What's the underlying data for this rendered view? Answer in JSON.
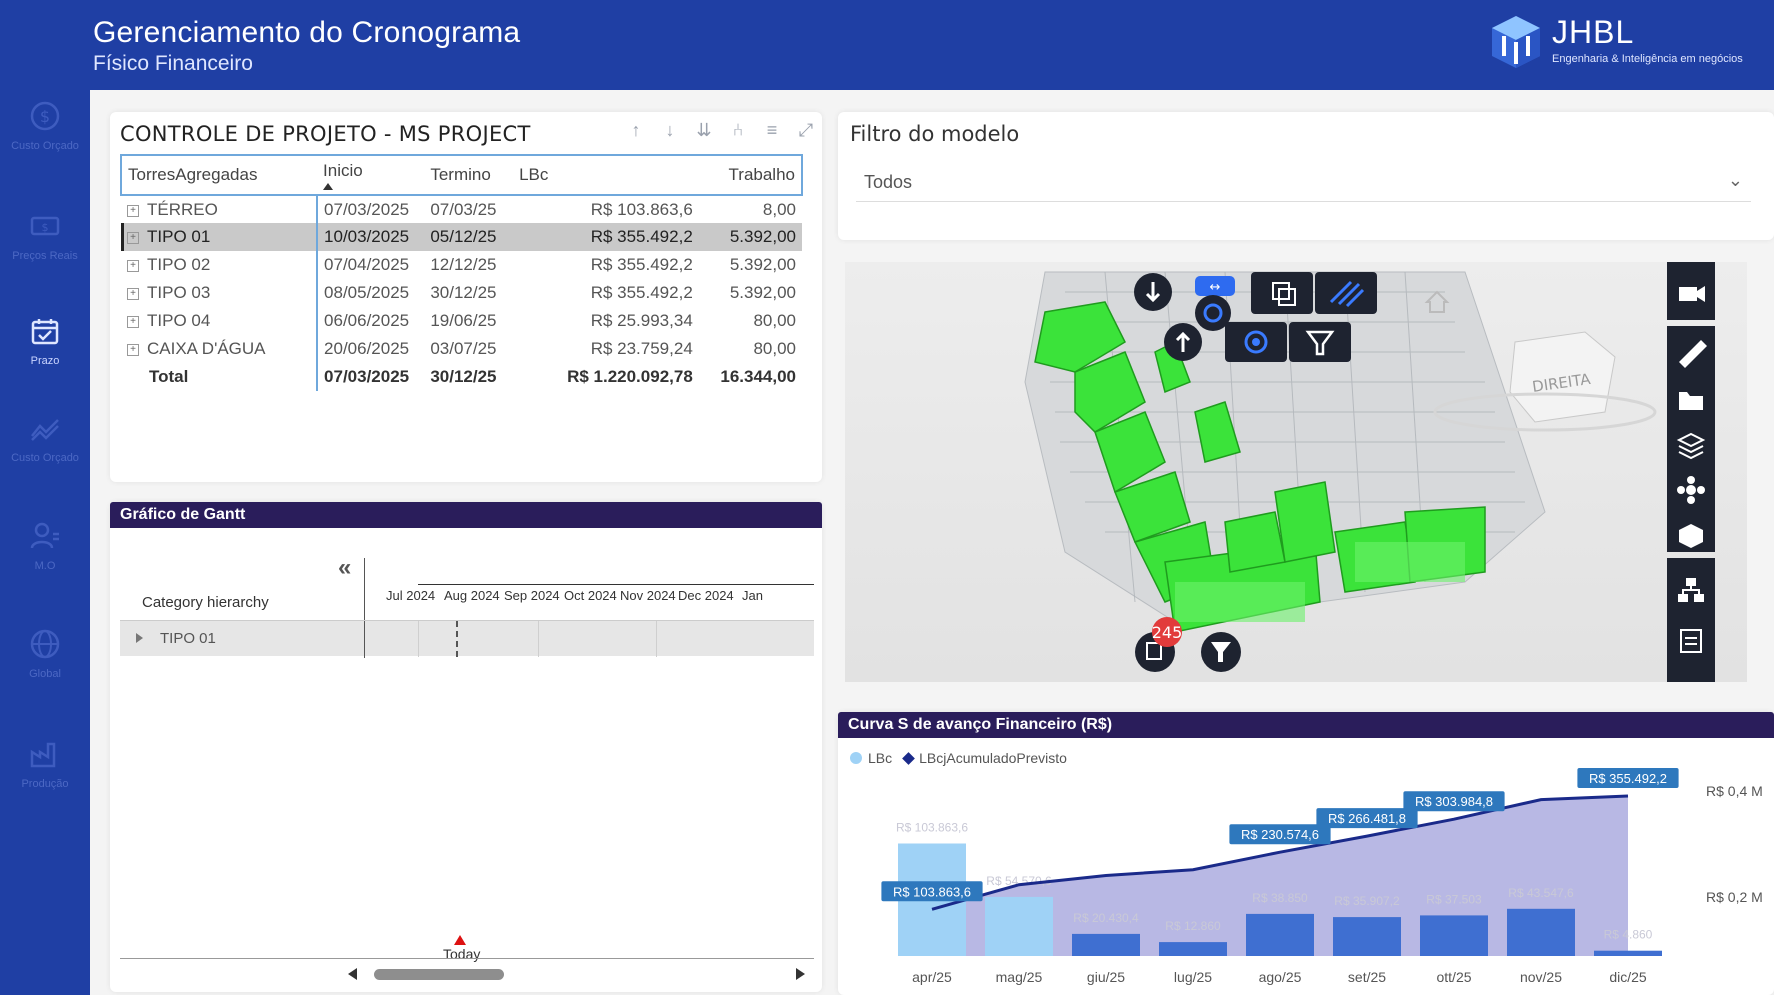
{
  "header": {
    "title": "Gerenciamento do Cronograma",
    "subtitle": "Físico Financeiro",
    "logo_text": "JHBL",
    "logo_tagline": "Engenharia & Inteligência em negócios"
  },
  "nav": {
    "items": [
      {
        "label": "Custo Orçado",
        "icon": "dollar-icon",
        "active": false
      },
      {
        "label": "Preços Reais",
        "icon": "money-icon",
        "active": false
      },
      {
        "label": "Prazo",
        "icon": "calendar-icon",
        "active": true
      },
      {
        "label": "Custo Orçado",
        "icon": "trend-icon",
        "active": false
      },
      {
        "label": "M.O",
        "icon": "worker-icon",
        "active": false
      },
      {
        "label": "Global",
        "icon": "globe-icon",
        "active": false
      },
      {
        "label": "Produção",
        "icon": "factory-icon",
        "active": false
      }
    ]
  },
  "table": {
    "title": "CONTROLE DE PROJETO - MS PROJECT",
    "columns": [
      "TorresAgregadas",
      "Inicio",
      "Termino",
      "LBc",
      "Trabalho"
    ],
    "rows": [
      {
        "name": "TÉRREO",
        "inicio": "07/03/2025",
        "termino": "07/03/25",
        "lbc": "R$ 103.863,6",
        "trabalho": "8,00",
        "selected": false
      },
      {
        "name": "TIPO 01",
        "inicio": "10/03/2025",
        "termino": "05/12/25",
        "lbc": "R$ 355.492,2",
        "trabalho": "5.392,00",
        "selected": true
      },
      {
        "name": "TIPO 02",
        "inicio": "07/04/2025",
        "termino": "12/12/25",
        "lbc": "R$ 355.492,2",
        "trabalho": "5.392,00",
        "selected": false
      },
      {
        "name": "TIPO 03",
        "inicio": "08/05/2025",
        "termino": "30/12/25",
        "lbc": "R$ 355.492,2",
        "trabalho": "5.392,00",
        "selected": false
      },
      {
        "name": "TIPO 04",
        "inicio": "06/06/2025",
        "termino": "19/06/25",
        "lbc": "R$ 25.993,34",
        "trabalho": "80,00",
        "selected": false
      },
      {
        "name": "CAIXA D'ÁGUA",
        "inicio": "20/06/2025",
        "termino": "03/07/25",
        "lbc": "R$ 23.759,24",
        "trabalho": "80,00",
        "selected": false
      }
    ],
    "total": {
      "name": "Total",
      "inicio": "07/03/2025",
      "termino": "30/12/25",
      "lbc": "R$ 1.220.092,78",
      "trabalho": "16.344,00"
    }
  },
  "filter": {
    "title": "Filtro do modelo",
    "selected": "Todos"
  },
  "viewer": {
    "badge_count": "245",
    "cube_label": "DIREITA"
  },
  "gantt": {
    "title": "Gráfico de Gantt",
    "hierarchy_label": "Category hierarchy",
    "collapse_symbol": "«",
    "months": [
      "Jul 2024",
      "Aug 2024",
      "Sep 2024",
      "Oct 2024",
      "Nov 2024",
      "Dec 2024",
      "Jan"
    ],
    "row_label": "TIPO 01",
    "today_label": "Today"
  },
  "curva": {
    "title": "Curva S de avanço Financeiro (R$)",
    "legend": [
      "LBc",
      "LBcjAcumuladoPrevisto"
    ],
    "colors": {
      "bars": "#3f6fd1",
      "bars_light": "#9fd2f6",
      "line": "#1a2a8a",
      "area": "#9a9ad8",
      "label_bg": "#2e78bd"
    }
  },
  "chart_data": {
    "type": "bar",
    "title": "Curva S de avanço Financeiro (R$)",
    "categories": [
      "apr/25",
      "mag/25",
      "giu/25",
      "lug/25",
      "ago/25",
      "set/25",
      "ott/25",
      "nov/25",
      "dic/25"
    ],
    "series": [
      {
        "name": "LBc",
        "values": [
          103863.6,
          54570.6,
          20430.4,
          12860,
          38850,
          35907.2,
          37503,
          43547.6,
          4860
        ]
      },
      {
        "name": "LBcjAcumuladoPrevisto",
        "values": [
          103863.6,
          158434.2,
          178864.6,
          191724.6,
          230574.6,
          266481.8,
          303984.8,
          347532.4,
          355492.2
        ]
      }
    ],
    "bar_labels": [
      "R$ 103.863,6",
      "R$ 54.570,6",
      "R$ 20.430,4",
      "R$ 12.860",
      "R$ 38.850",
      "R$ 35.907,2",
      "R$ 37.503",
      "R$ 43.547,6",
      "R$ 4.860"
    ],
    "line_labels": [
      {
        "index": 0,
        "text": "R$ 103.863,6"
      },
      {
        "index": 4,
        "text": "R$ 230.574,6"
      },
      {
        "index": 5,
        "text": "R$ 266.481,8"
      },
      {
        "index": 6,
        "text": "R$ 303.984,8"
      },
      {
        "index": 8,
        "text": "R$ 355.492,2"
      }
    ],
    "y_right_ticks": [
      "R$ 0,4 M",
      "R$ 0,2 M"
    ]
  }
}
